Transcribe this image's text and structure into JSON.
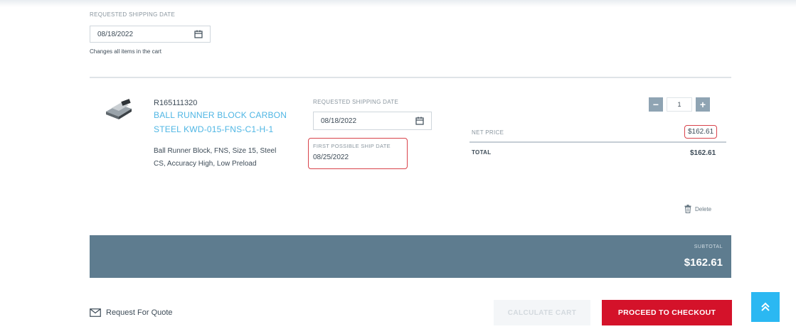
{
  "cart_header": {
    "requested_date_label": "REQUESTED SHIPPING DATE",
    "requested_date_value": "08/18/2022",
    "note": "Changes all items in the cart"
  },
  "item": {
    "sku": "R165111320",
    "name_line1": "BALL RUNNER BLOCK CARBON",
    "name_line2": "STEEL KWD-015-FNS-C1-H-1",
    "description_line1": "Ball Runner Block, FNS, Size 15, Steel",
    "description_line2": "CS, Accuracy High, Low Preload",
    "requested_date_label": "REQUESTED SHIPPING DATE",
    "requested_date_value": "08/18/2022",
    "first_ship_label": "FIRST POSSIBLE SHIP DATE",
    "first_ship_value": "08/25/2022",
    "quantity": "1",
    "qty_minus": "−",
    "qty_plus": "+",
    "net_price_label": "NET PRICE",
    "net_price_value": "$162.61",
    "total_label": "TOTAL",
    "total_value": "$162.61",
    "delete_label": "Delete"
  },
  "subtotal": {
    "label": "SUBTOTAL",
    "value": "$162.61"
  },
  "footer": {
    "rfq_label": "Request For Quote",
    "calculate_label": "CALCULATE CART",
    "checkout_label": "PROCEED TO CHECKOUT"
  },
  "colors": {
    "accent_link": "#4fb6e4",
    "highlight_border": "#d9434b",
    "subtotal_bar": "#5e7c8f",
    "checkout_button": "#d4122a",
    "scroll_top_button": "#2bb8f2"
  },
  "icons": [
    "calendar-icon",
    "product-thumbnail",
    "trash-icon",
    "envelope-icon",
    "chevron-double-up-icon"
  ]
}
